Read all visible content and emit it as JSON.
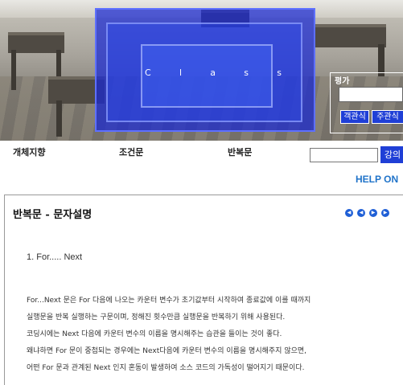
{
  "banner": {
    "title_letters": [
      "C",
      "l",
      "a",
      "s",
      "s"
    ],
    "evaluation": {
      "label": "평가",
      "buttons": [
        "객관식",
        "주관식"
      ]
    }
  },
  "nav": {
    "items": [
      "개체지향",
      "조건문",
      "반복문"
    ],
    "search_button": "강의"
  },
  "help_label": "HELP ON",
  "content": {
    "title": "반복문 - 문자설명",
    "subheading": "1. For..... Next",
    "paragraphs": [
      "For...Next 문은 For 다음에 나오는 카운터 변수가 초기값부터 시작하여 종료값에 이를 때까지",
      "실행문을 반복 실행하는 구문이며, 정해진 횟수만큼 실행문을 반복하기 위해 사용된다.",
      "코딩시에는 Next 다음에 카운터 변수의 이름을 명시해주는 습관을 들이는 것이 좋다.",
      "왜냐하면 For 문이 중첩되는 경우에는 Next다음에 카운터 변수의 이름을 명시해주지 않으면,",
      "어떤 For 문과 관계된 Next 인지 혼동이 발생하여 소스 코드의 가독성이 떨어지기 때문이다."
    ]
  },
  "pager_icons": [
    "first-icon",
    "prev-icon",
    "next-icon",
    "last-icon"
  ],
  "colors": {
    "button_blue": "#1f3fd6",
    "help_blue": "#1f73c9",
    "banner_blue": "#1a28d2"
  }
}
